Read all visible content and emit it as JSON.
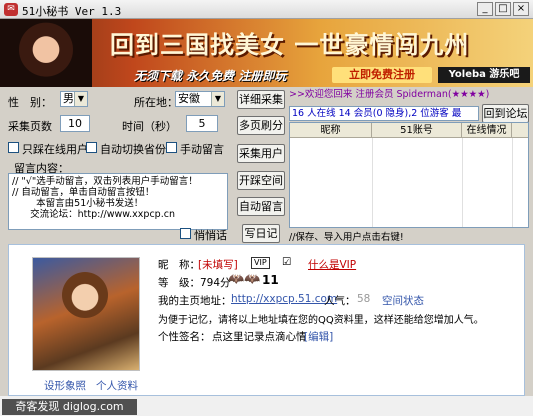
{
  "window": {
    "title": "51小秘书 Ver 1.3",
    "minimize": "_",
    "maximize": "□",
    "close": "×"
  },
  "banner": {
    "headline": "回到三国找美女 一世豪情闯九州",
    "subline": "无须下载 永久免费 注册即玩",
    "register_label": "立即免费注册",
    "brand": "Yoleba 游乐吧"
  },
  "form": {
    "gender_label": "性　别：",
    "gender_value": "男",
    "location_label": "所在地：",
    "location_value": "安徽",
    "pages_label": "采集页数",
    "pages_value": "10",
    "interval_label": "时间（秒）",
    "interval_value": "5",
    "only_online_label": "只踩在线用户",
    "auto_switch_label": "自动切换省份",
    "manual_msg_label": "手动留言",
    "message_label": "留言内容：",
    "message_text": "// \"√\"选手动留言，双击列表用户手动留言！\n// 自动留言，单击自动留言按钮！\n        本留言由51小秘书发送！\n      交流论坛：http://www.xxpcp.cn",
    "whisper_label": "悄悄话"
  },
  "buttons": {
    "detail_collect": "详细采集",
    "multi_refresh": "多页刷分",
    "collect_users": "采集用户",
    "open_space": "开踩空间",
    "auto_message": "自动留言",
    "write_log": "写日记",
    "back_forum": "回到论坛"
  },
  "status": {
    "welcome": ">>欢迎您回来 注册会员 Spiderman(★★★★)",
    "online": "16 人在线 14 会员(0 隐身),2 位游客 最",
    "grid_hint": "//保存、导入用户点击右键!"
  },
  "grid": {
    "columns": [
      "昵称",
      "51账号",
      "在线情况"
    ],
    "rows": []
  },
  "profile": {
    "nick_label": "昵　称：",
    "nick_value": "[未填写]",
    "vip_badge": "VIP",
    "what_vip": "什么是VIP",
    "level_label": "等　级：794分",
    "level_num": "11",
    "home_label": "我的主页地址：",
    "home_url": "http://xxpcp.51.com",
    "pop_label": "人气：",
    "pop_value": "58",
    "space_status": "空间状态",
    "note": "为便于记忆，请将以上地址填在您的QQ资料里，这样还能给您增加人气。",
    "sign_label": "个性签名：",
    "sign_value": "点这里记录点滴心情",
    "edit_label": "[编辑]",
    "photo_link": "设形象照",
    "info_link": "个人资料"
  },
  "footer": {
    "watermark": "奇客发现 diglog.com"
  }
}
